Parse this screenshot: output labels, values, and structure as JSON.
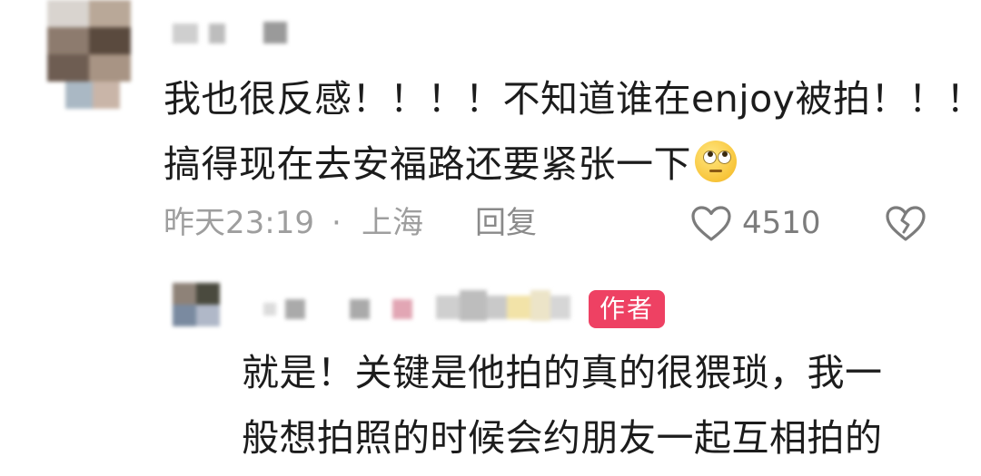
{
  "comment": {
    "line1": "我也很反感！！！！不知道谁在enjoy被拍！！！",
    "line2": "搞得现在去安福路还要紧张一下",
    "emoji": "eye-roll-emoji",
    "time": "昨天23:19",
    "separator": "·",
    "location": "上海",
    "reply_label": "回复",
    "like_count": "4510",
    "like_icon": "heart-outline-icon",
    "dislike_icon": "broken-heart-icon"
  },
  "reply": {
    "badge": "作者",
    "badge_color": "#ee4163",
    "line1": "就是！关键是他拍的真的很猥琐，我一",
    "line2": "般想拍照的时候会约朋友一起互相拍的"
  }
}
